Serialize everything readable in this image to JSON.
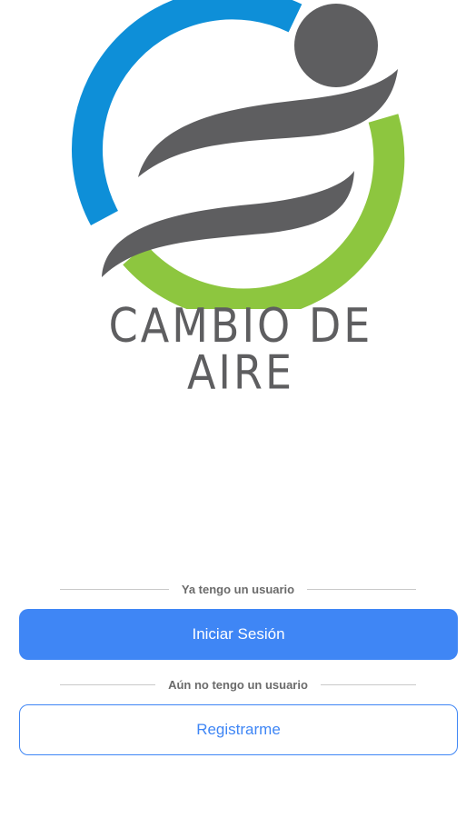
{
  "logo": {
    "text": "CAMBIO DE AIRE",
    "colors": {
      "blue": "#0e8fd8",
      "green": "#8dc63f",
      "gray": "#5e5e60"
    }
  },
  "login_section": {
    "divider_label": "Ya tengo un usuario",
    "button_label": "Iniciar Sesión"
  },
  "register_section": {
    "divider_label": "Aún no tengo un usuario",
    "button_label": "Registrarme"
  },
  "theme": {
    "accent": "#3f86f5",
    "divider_text": "#6b6b6b",
    "divider_line": "#c9c9c9"
  }
}
